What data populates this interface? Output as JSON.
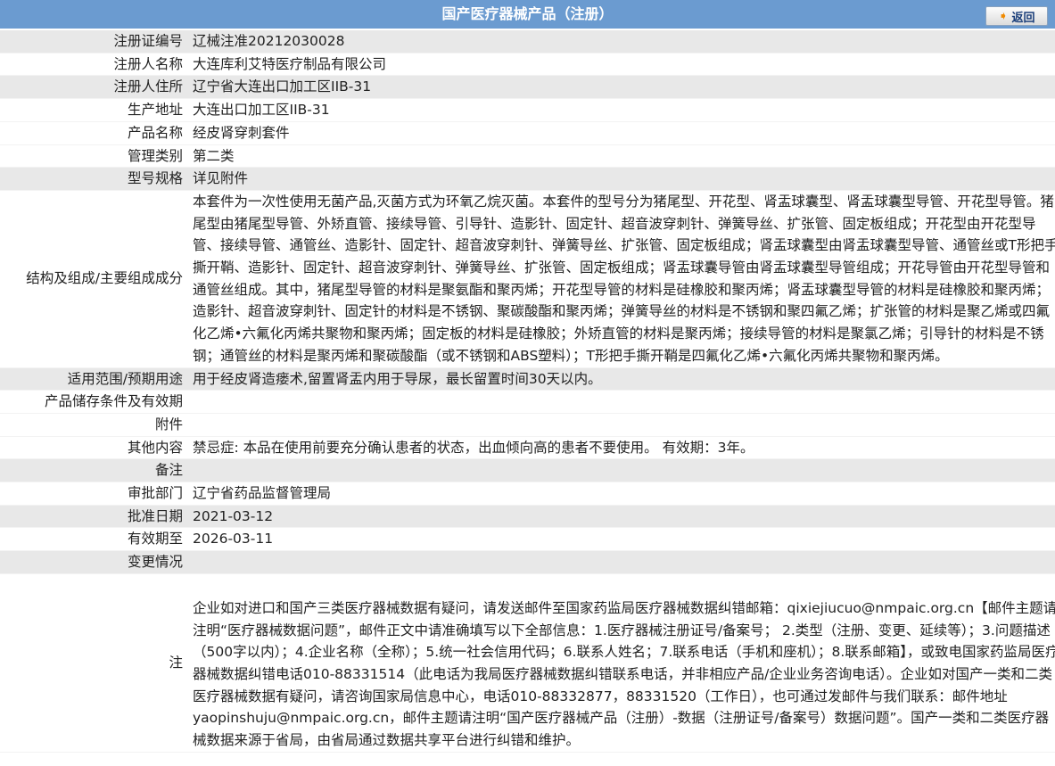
{
  "header": {
    "title": "国产医疗器械产品（注册）",
    "back_label": "返回"
  },
  "rows": [
    {
      "label": "注册证编号",
      "value": "辽械注准20212030028"
    },
    {
      "label": "注册人名称",
      "value": "大连库利艾特医疗制品有限公司"
    },
    {
      "label": "注册人住所",
      "value": "辽宁省大连出口加工区IIB-31"
    },
    {
      "label": "生产地址",
      "value": "大连出口加工区IIB-31"
    },
    {
      "label": "产品名称",
      "value": "经皮肾穿刺套件"
    },
    {
      "label": "管理类别",
      "value": "第二类"
    },
    {
      "label": "型号规格",
      "value": "详见附件"
    },
    {
      "label": "结构及组成/主要组成成分",
      "value": "本套件为一次性使用无菌产品,灭菌方式为环氧乙烷灭菌。本套件的型号分为猪尾型、开花型、肾盂球囊型、肾盂球囊型导管、开花型导管。猪尾型由猪尾型导管、外矫直管、接续导管、引导针、造影针、固定针、超音波穿刺针、弹簧导丝、扩张管、固定板组成；开花型由开花型导管、接续导管、通管丝、造影针、固定针、超音波穿刺针、弹簧导丝、扩张管、固定板组成；肾盂球囊型由肾盂球囊型导管、通管丝或T形把手撕开鞘、造影针、固定针、超音波穿刺针、弹簧导丝、扩张管、固定板组成；肾盂球囊导管由肾盂球囊型导管组成；开花导管由开花型导管和通管丝组成。其中，猪尾型导管的材料是聚氨酯和聚丙烯；开花型导管的材料是硅橡胶和聚丙烯；肾盂球囊型导管的材料是硅橡胶和聚丙烯；造影针、超音波穿刺针、固定针的材料是不锈钢、聚碳酸酯和聚丙烯；弹簧导丝的材料是不锈钢和聚四氟乙烯；扩张管的材料是聚乙烯或四氟化乙烯•六氟化丙烯共聚物和聚丙烯；固定板的材料是硅橡胶；外矫直管的材料是聚丙烯；接续导管的材料是聚氯乙烯；引导针的材料是不锈钢；通管丝的材料是聚丙烯和聚碳酸酯（或不锈钢和ABS塑料）；T形把手撕开鞘是四氟化乙烯•六氟化丙烯共聚物和聚丙烯。"
    },
    {
      "label": "适用范围/预期用途",
      "value": "用于经皮肾造瘘术,留置肾盂内用于导尿，最长留置时间30天以内。"
    },
    {
      "label": "产品储存条件及有效期",
      "value": ""
    },
    {
      "label": "附件",
      "value": ""
    },
    {
      "label": "其他内容",
      "value": "禁忌症: 本品在使用前要充分确认患者的状态，出血倾向高的患者不要使用。 有效期：3年。"
    },
    {
      "label": "备注",
      "value": ""
    },
    {
      "label": "审批部门",
      "value": "辽宁省药品监督管理局"
    },
    {
      "label": "批准日期",
      "value": "2021-03-12"
    },
    {
      "label": "有效期至",
      "value": "2026-03-11"
    },
    {
      "label": "变更情况",
      "value": ""
    }
  ],
  "note": {
    "label": "注",
    "value": "企业如对进口和国产三类医疗器械数据有疑问，请发送邮件至国家药监局医疗器械数据纠错邮箱：qixiejiucuo@nmpaic.org.cn【邮件主题请注明“医疗器械数据问题”，邮件正文中请准确填写以下全部信息：1.医疗器械注册证号/备案号； 2.类型（注册、变更、延续等）；3.问题描述（500字以内）；4.企业名称（全称）；5.统一社会信用代码；6.联系人姓名；7.联系电话（手机和座机）；8.联系邮箱】，或致电国家药监局医疗器械数据纠错电话010-88331514（此电话为我局医疗器械数据纠错联系电话，并非相应产品/企业业务咨询电话）。企业如对国产一类和二类医疗器械数据有疑问，请咨询国家局信息中心，电话010-88332877，88331520（工作日），也可通过发邮件与我们联系：邮件地址yaopinshuju@nmpaic.org.cn，邮件主题请注明“国产医疗器械产品（注册）-数据（注册证号/备案号）数据问题”。国产一类和二类医疗器械数据来源于省局，由省局通过数据共享平台进行纠错和维护。"
  }
}
